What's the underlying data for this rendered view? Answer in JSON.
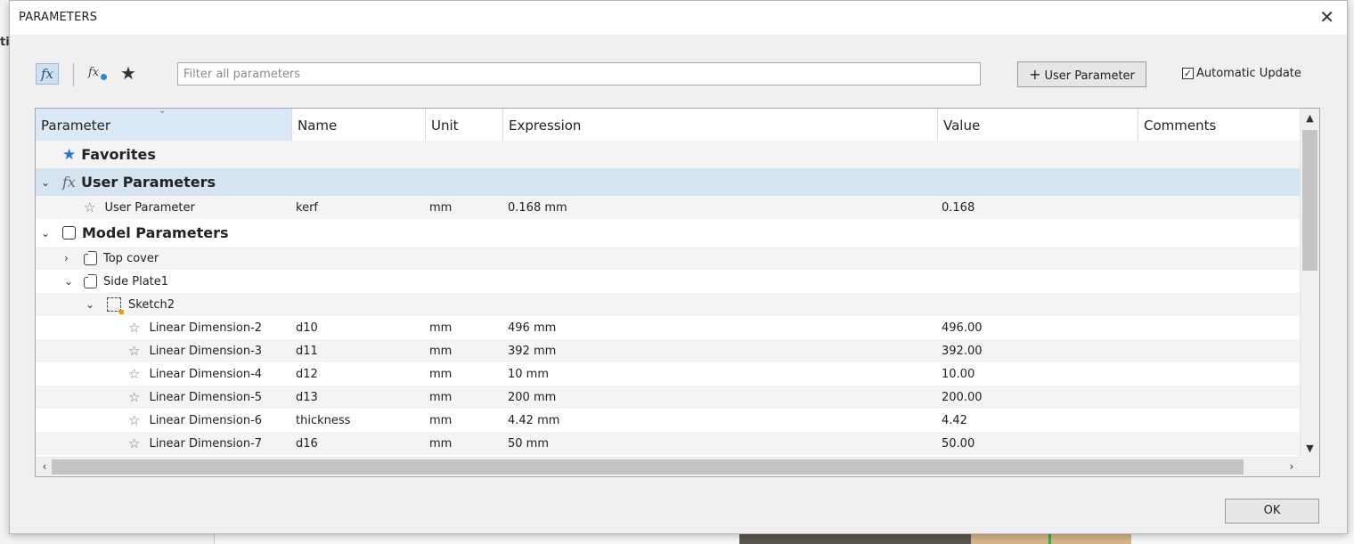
{
  "dialog": {
    "title": "PARAMETERS",
    "close_icon": "close-icon"
  },
  "toolbar": {
    "fx_icon_text": "fx",
    "fx_user_icon_text": "fx",
    "filter_placeholder": "Filter all parameters",
    "filter_value": "",
    "user_parameter_button": "User Parameter",
    "auto_update_label": "Automatic Update",
    "auto_update_checked": true
  },
  "columns": [
    "Parameter",
    "Name",
    "Unit",
    "Expression",
    "Value",
    "Comments"
  ],
  "groups": {
    "favorites": "Favorites",
    "user_parameters": "User Parameters",
    "model_parameters": "Model Parameters"
  },
  "user_params": [
    {
      "parameter": "User Parameter",
      "name": "kerf",
      "unit": "mm",
      "expression": "0.168 mm",
      "value": "0.168",
      "comments": ""
    }
  ],
  "components": {
    "top_cover": "Top cover",
    "side_plate": "Side Plate1",
    "sketch": "Sketch2"
  },
  "dimensions": [
    {
      "parameter": "Linear Dimension-2",
      "name": "d10",
      "unit": "mm",
      "expression": "496 mm",
      "value": "496.00",
      "comments": ""
    },
    {
      "parameter": "Linear Dimension-3",
      "name": "d11",
      "unit": "mm",
      "expression": "392 mm",
      "value": "392.00",
      "comments": ""
    },
    {
      "parameter": "Linear Dimension-4",
      "name": "d12",
      "unit": "mm",
      "expression": "10 mm",
      "value": "10.00",
      "comments": ""
    },
    {
      "parameter": "Linear Dimension-5",
      "name": "d13",
      "unit": "mm",
      "expression": "200 mm",
      "value": "200.00",
      "comments": ""
    },
    {
      "parameter": "Linear Dimension-6",
      "name": "thickness",
      "unit": "mm",
      "expression": "4.42 mm",
      "value": "4.42",
      "comments": ""
    },
    {
      "parameter": "Linear Dimension-7",
      "name": "d16",
      "unit": "mm",
      "expression": "50 mm",
      "value": "50.00",
      "comments": ""
    }
  ],
  "footer": {
    "ok_button": "OK"
  },
  "background": {
    "left_edge_text": "ti"
  },
  "colors": {
    "selected_row": "#d6e4f1",
    "favorites_star": "#1f7bd0",
    "header_sorted": "#dbe8f5"
  }
}
